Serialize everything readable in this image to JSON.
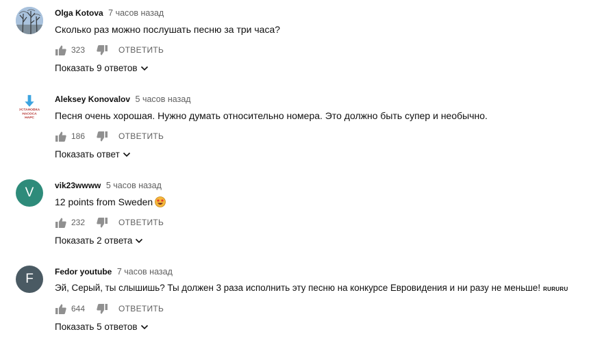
{
  "comments": [
    {
      "author": "Olga Kotova",
      "time": "7 часов назад",
      "text": "Сколько раз можно послушать песню за три часа?",
      "likes": "323",
      "reply_label": "ОТВЕТИТЬ",
      "replies_label": "Показать 9 ответов",
      "avatar_type": "photo-trees"
    },
    {
      "author": "Aleksey Konovalov",
      "time": "5 часов назад",
      "text": "Песня очень хорошая. Нужно думать относительно номера. Это должно быть супер и необычно.",
      "likes": "186",
      "reply_label": "ОТВЕТИТЬ",
      "replies_label": "Показать ответ",
      "avatar_type": "logo",
      "avatar_logo_lines": [
        "УСТАНОВКА",
        "НАСОСА",
        "НАРС"
      ]
    },
    {
      "author": "vik23wwww",
      "time": "5 часов назад",
      "text": "12 points from Sweden",
      "emoji": "star-struck-icon",
      "likes": "232",
      "reply_label": "ОТВЕТИТЬ",
      "replies_label": "Показать 2 ответа",
      "avatar_letter": "V",
      "avatar_color": "#2e8b7a"
    },
    {
      "author": "Fedor youtube",
      "time": "7 часов назад",
      "text": "Эй, Серый, ты слышишь? Ты должен 3 раза исполнить эту песню на конкурсе Евровидения и ни разу не меньше!",
      "tag": "RURURU",
      "likes": "644",
      "reply_label": "ОТВЕТИТЬ",
      "replies_label": "Показать 5 ответов",
      "avatar_letter": "F",
      "avatar_color": "#4a5a63"
    }
  ]
}
